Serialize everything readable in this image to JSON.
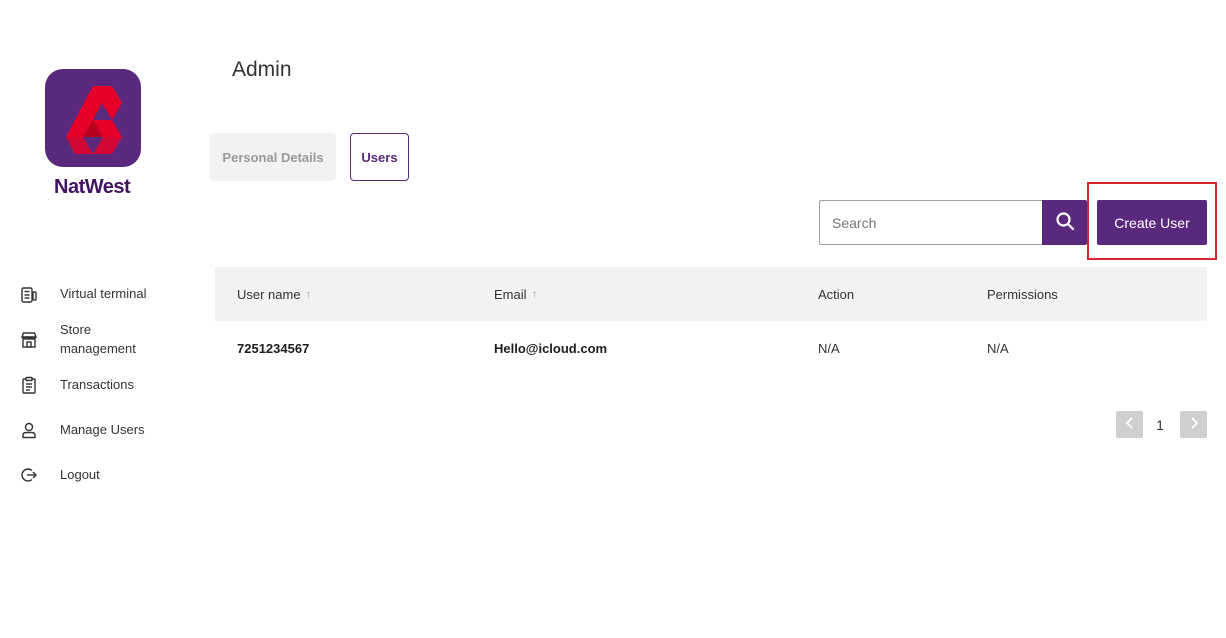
{
  "brand": {
    "name": "NatWest",
    "primary_color": "#5a287d",
    "logo_icon": "natwest-logo"
  },
  "page": {
    "title": "Admin"
  },
  "tabs": [
    {
      "label": "Personal Details",
      "active": false
    },
    {
      "label": "Users",
      "active": true
    }
  ],
  "sidebar": {
    "items": [
      {
        "label": "Virtual terminal",
        "icon": "card-terminal-icon"
      },
      {
        "label": "Store management",
        "icon": "store-icon"
      },
      {
        "label": "Transactions",
        "icon": "clipboard-icon"
      },
      {
        "label": "Manage Users",
        "icon": "user-icon"
      },
      {
        "label": "Logout",
        "icon": "logout-icon"
      }
    ]
  },
  "toolbar": {
    "search_placeholder": "Search",
    "search_value": "",
    "create_label": "Create User",
    "highlight_color": "#d9252e"
  },
  "table": {
    "headers": [
      "User name",
      "Email",
      "Action",
      "Permissions"
    ],
    "sort_indicator": "↑",
    "rows": [
      {
        "username": "7251234567",
        "email": "Hello@icloud.com",
        "action": "N/A",
        "permissions": "N/A"
      }
    ]
  },
  "pagination": {
    "current": "1",
    "prev": "‹",
    "next": "›"
  }
}
